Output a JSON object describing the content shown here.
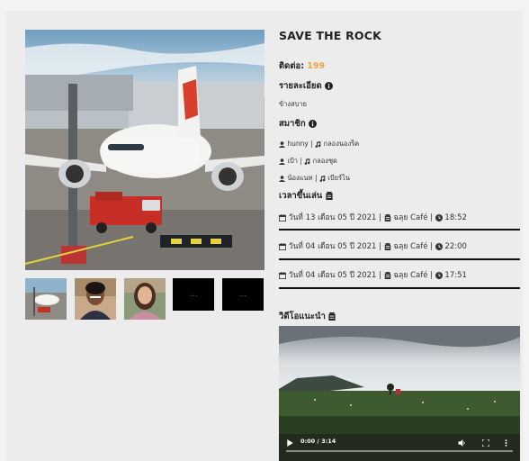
{
  "page": {
    "title": "SAVE THE ROCK",
    "contact_label": "ติดต่อ:",
    "contact_value": "199",
    "detail_label": "รายละเอียด",
    "detail_text": "ข้างสบาย",
    "members_label": "สมาชิก",
    "members": [
      {
        "name": "hunny",
        "role": "กลองนองร็ค"
      },
      {
        "name": "เป้า",
        "role": "กลองชุด"
      },
      {
        "name": "น้องแนท",
        "role": "เบียร์ไน"
      }
    ],
    "schedule_label": "เวลาขึ้นเล่น",
    "schedules": [
      {
        "date": "วันที่ 13 เดือน 05 ปี 2021",
        "venue": "ฉลุย Café",
        "time": "18:52"
      },
      {
        "date": "วันที่ 04 เดือน 05 ปี 2021",
        "venue": "ฉลุย Café",
        "time": "22:00"
      },
      {
        "date": "วันที่ 04 เดือน 05 ปี 2021",
        "venue": "ฉลุย Café",
        "time": "17:51"
      }
    ],
    "separator": "|",
    "video_label": "วิดีโอแนะนำ",
    "video_time": "0:00 / 3:14",
    "thumb_dark_label": "..."
  },
  "icons": {
    "info": "info-circle-icon",
    "user": "user-icon",
    "music": "music-note-icon",
    "calendar": "calendar-icon",
    "store": "store-icon",
    "clock": "clock-icon",
    "play": "play-icon",
    "volume": "volume-icon",
    "fullscreen": "fullscreen-icon",
    "more": "more-vertical-icon"
  },
  "colors": {
    "accent": "#f0a640",
    "text": "#222222",
    "panel": "#ececec"
  }
}
